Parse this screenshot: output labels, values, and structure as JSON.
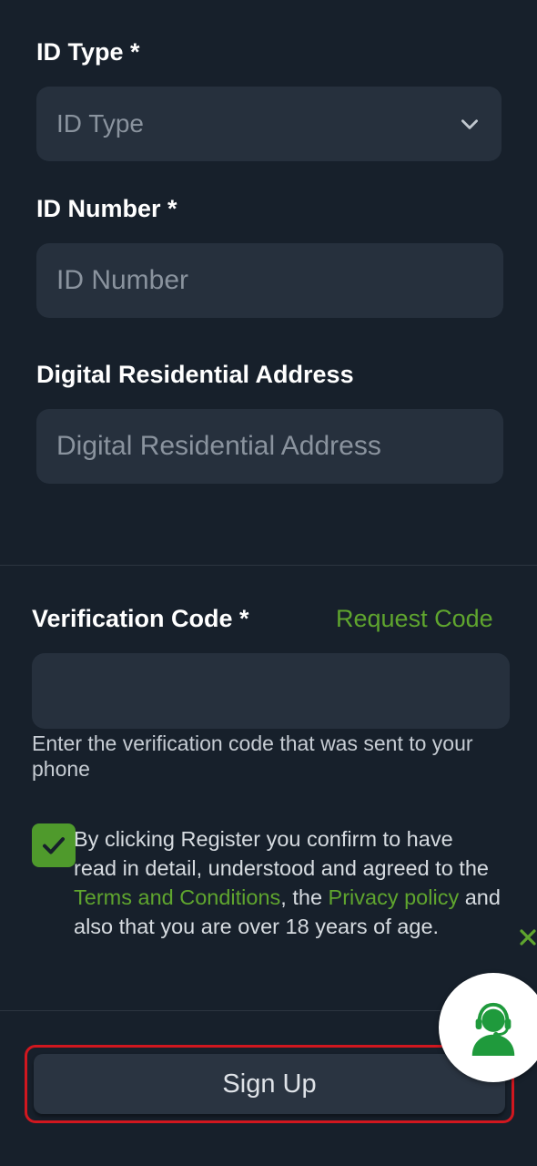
{
  "id_type": {
    "label": "ID Type *",
    "placeholder": "ID Type"
  },
  "id_number": {
    "label": "ID Number *",
    "placeholder": "ID Number"
  },
  "address": {
    "label": "Digital Residential Address",
    "placeholder": "Digital Residential Address"
  },
  "verification": {
    "label": "Verification Code *",
    "request_link": "Request Code",
    "value": "",
    "helper": "Enter the verification code that was sent to your phone"
  },
  "consent": {
    "checked": true,
    "text_1": "By clicking Register you confirm to have read in detail, understood and agreed to the ",
    "terms_link": "Terms and Conditions",
    "text_2": ", the ",
    "privacy_link": "Privacy policy",
    "text_3": " and also that you are over 18 years of age."
  },
  "signup_button": "Sign Up",
  "colors": {
    "background": "#17202b",
    "field": "#26303d",
    "accent": "#5fa52e",
    "highlight": "#d1171f"
  }
}
